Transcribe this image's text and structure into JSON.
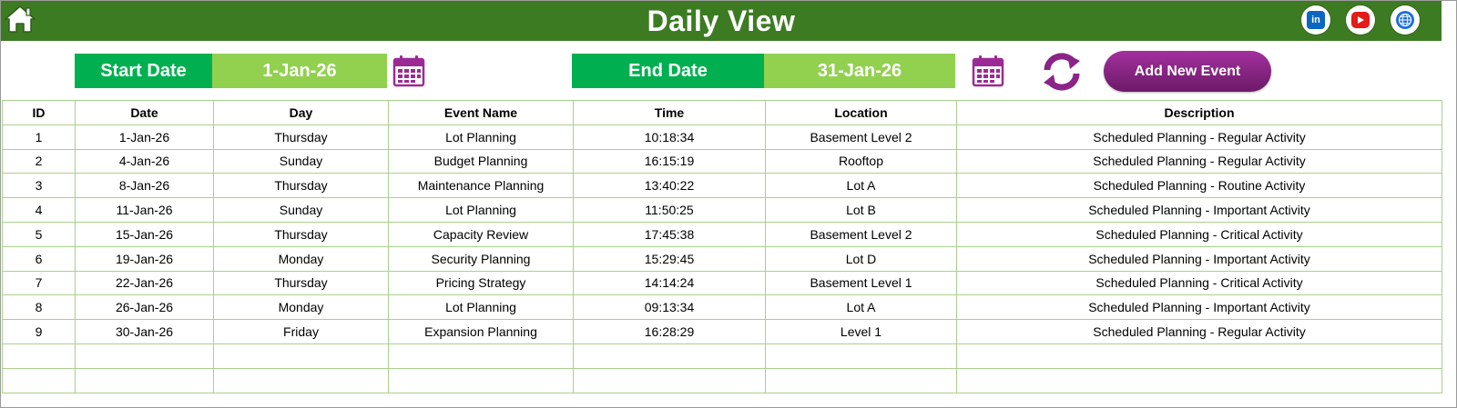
{
  "header": {
    "title": "Daily View",
    "icons": {
      "home": "home-icon",
      "linkedin": "linkedin-icon",
      "youtube": "youtube-icon",
      "website": "globe-icon"
    },
    "colors": {
      "header_bg": "#3d7b22",
      "label_bg": "#00b050",
      "value_bg": "#92d050",
      "button": "#8b2388",
      "grid": "#a9d08e"
    }
  },
  "filters": {
    "start_label": "Start Date",
    "start_value": "1-Jan-26",
    "end_label": "End Date",
    "end_value": "31-Jan-26"
  },
  "actions": {
    "add_label": "Add New Event"
  },
  "table": {
    "columns": [
      "ID",
      "Date",
      "Day",
      "Event Name",
      "Time",
      "Location",
      "Description"
    ],
    "rows": [
      [
        "1",
        "1-Jan-26",
        "Thursday",
        "Lot Planning",
        "10:18:34",
        "Basement Level 2",
        "Scheduled Planning - Regular Activity"
      ],
      [
        "2",
        "4-Jan-26",
        "Sunday",
        "Budget Planning",
        "16:15:19",
        "Rooftop",
        "Scheduled Planning - Regular Activity"
      ],
      [
        "3",
        "8-Jan-26",
        "Thursday",
        "Maintenance Planning",
        "13:40:22",
        "Lot A",
        "Scheduled Planning - Routine Activity"
      ],
      [
        "4",
        "11-Jan-26",
        "Sunday",
        "Lot Planning",
        "11:50:25",
        "Lot B",
        "Scheduled Planning - Important Activity"
      ],
      [
        "5",
        "15-Jan-26",
        "Thursday",
        "Capacity Review",
        "17:45:38",
        "Basement Level 2",
        "Scheduled Planning - Critical Activity"
      ],
      [
        "6",
        "19-Jan-26",
        "Monday",
        "Security Planning",
        "15:29:45",
        "Lot D",
        "Scheduled Planning - Important Activity"
      ],
      [
        "7",
        "22-Jan-26",
        "Thursday",
        "Pricing Strategy",
        "14:14:24",
        "Basement Level 1",
        "Scheduled Planning - Critical Activity"
      ],
      [
        "8",
        "26-Jan-26",
        "Monday",
        "Lot Planning",
        "09:13:34",
        "Lot A",
        "Scheduled Planning - Important Activity"
      ],
      [
        "9",
        "30-Jan-26",
        "Friday",
        "Expansion Planning",
        "16:28:29",
        "Level 1",
        "Scheduled Planning - Regular Activity"
      ]
    ],
    "empty_rows": 2
  }
}
